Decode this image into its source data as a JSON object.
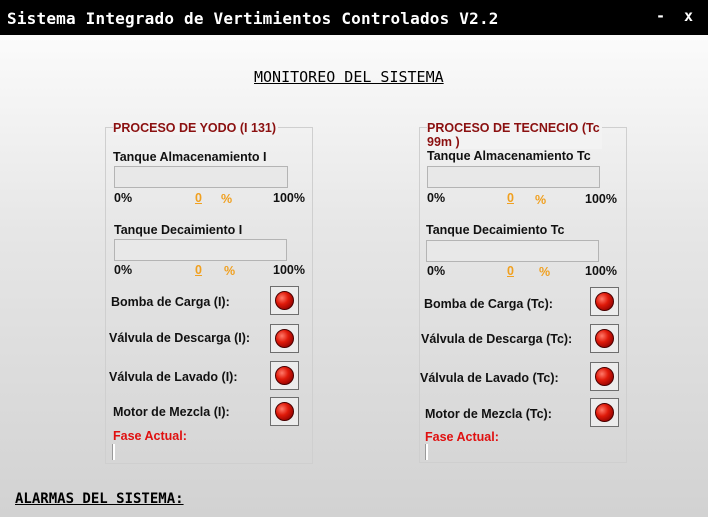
{
  "window": {
    "title": "Sistema Integrado de Vertimientos Controlados V2.2",
    "minimize": "-",
    "close": "x"
  },
  "main_title": "MONITOREO DEL SISTEMA",
  "alarms_title": "ALARMAS DEL SISTEMA:",
  "colors": {
    "titlebar": "#000000",
    "group_title": "#8b1010",
    "percent": "#f0a020",
    "phase": "#e01010",
    "led": "#e01a0a"
  },
  "process_iodine": {
    "title": "PROCESO DE YODO (I 131)",
    "storage_tank": {
      "label": "Tanque Almacenamiento I",
      "min": "0%",
      "value": "0",
      "unit": "%",
      "max": "100%",
      "level": 0
    },
    "decay_tank": {
      "label": "Tanque Decaimiento I",
      "min": "0%",
      "value": "0",
      "unit": "%",
      "max": "100%",
      "level": 0
    },
    "indicators": [
      {
        "label": "Bomba de Carga (I):",
        "state": "red"
      },
      {
        "label": "Válvula de Descarga (I):",
        "state": "red"
      },
      {
        "label": "Válvula de Lavado (I):",
        "state": "red"
      },
      {
        "label": "Motor de Mezcla  (I):",
        "state": "red"
      }
    ],
    "phase_label": "Fase Actual:"
  },
  "process_technetium": {
    "title_line1": "PROCESO DE TECNECIO (Tc",
    "title_line2": "99m )",
    "storage_tank": {
      "label": "Tanque Almacenamiento Tc",
      "min": "0%",
      "value": "0",
      "unit": "%",
      "max": "100%",
      "level": 0
    },
    "decay_tank": {
      "label": "Tanque Decaimiento Tc",
      "min": "0%",
      "value": "0",
      "unit": "%",
      "max": "100%",
      "level": 0
    },
    "indicators": [
      {
        "label": "Bomba de Carga (Tc):",
        "state": "red"
      },
      {
        "label": "Válvula de Descarga (Tc):",
        "state": "red"
      },
      {
        "label": "Válvula de Lavado (Tc):",
        "state": "red"
      },
      {
        "label": "Motor de Mezcla  (Tc):",
        "state": "red"
      }
    ],
    "phase_label": "Fase Actual:"
  }
}
